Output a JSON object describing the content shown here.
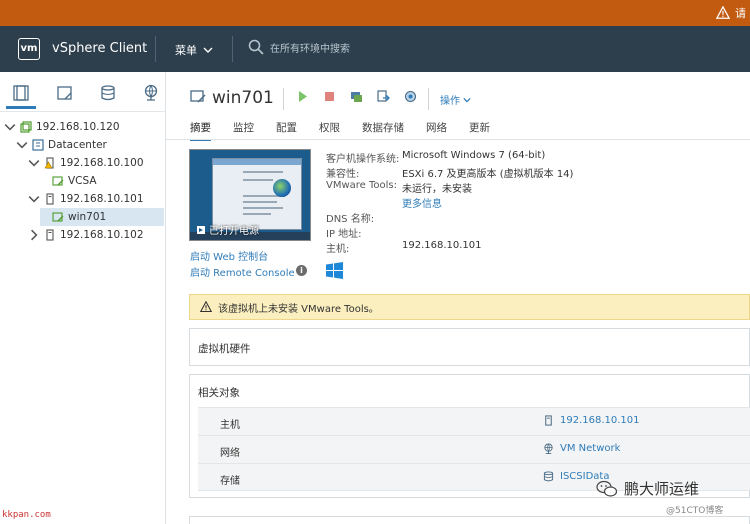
{
  "alert": {
    "text": "请"
  },
  "header": {
    "logo": "vm",
    "app_title": "vSphere Client",
    "menu_label": "菜单",
    "search_placeholder": "在所有环境中搜索"
  },
  "sidebar": {
    "tabs": [
      "hosts-and-clusters-icon",
      "vms-and-templates-icon",
      "storage-icon",
      "networking-icon"
    ],
    "tree": [
      {
        "label": "192.168.10.120",
        "level": 0,
        "expanded": true,
        "icon": "vcenter-icon"
      },
      {
        "label": "Datacenter",
        "level": 1,
        "expanded": true,
        "icon": "datacenter-icon"
      },
      {
        "label": "192.168.10.100",
        "level": 2,
        "expanded": true,
        "icon": "host-warning-icon"
      },
      {
        "label": "VCSA",
        "level": 3,
        "icon": "vm-icon"
      },
      {
        "label": "192.168.10.101",
        "level": 2,
        "expanded": true,
        "icon": "host-icon"
      },
      {
        "label": "win701",
        "level": 3,
        "icon": "vm-icon",
        "selected": true
      },
      {
        "label": "192.168.10.102",
        "level": 2,
        "expanded": false,
        "icon": "host-icon"
      }
    ]
  },
  "vm": {
    "name": "win701",
    "actions_label": "操作",
    "tabs": [
      "摘要",
      "监控",
      "配置",
      "权限",
      "数据存储",
      "网络",
      "更新"
    ],
    "active_tab": "摘要",
    "console_status": "已打开电源",
    "console_links": [
      "启动 Web 控制台",
      "启动 Remote Console"
    ],
    "properties": [
      {
        "label": "客户机操作系统:",
        "value": "Microsoft Windows 7 (64-bit)"
      },
      {
        "label": "兼容性:",
        "value": "ESXi 6.7 及更高版本 (虚拟机版本 14)"
      },
      {
        "label": "VMware Tools:",
        "value": "未运行，未安装"
      },
      {
        "label": "",
        "value": "更多信息"
      },
      {
        "label": "DNS 名称:",
        "value": ""
      },
      {
        "label": "IP 地址:",
        "value": ""
      },
      {
        "label": "主机:",
        "value": "192.168.10.101"
      }
    ],
    "warning_banner": "该虚拟机上未安装 VMware Tools。",
    "hardware_card_title": "虚拟机硬件",
    "related_card_title": "相关对象",
    "related": [
      {
        "key": "主机",
        "value": "192.168.10.101",
        "icon": "host-icon"
      },
      {
        "key": "网络",
        "value": "VM Network",
        "icon": "network-icon"
      },
      {
        "key": "存储",
        "value": "ISCSIData",
        "icon": "datastore-icon"
      }
    ]
  },
  "watermark": {
    "main": "鹏大师运维",
    "sub": "@51CTO博客"
  },
  "source_mark": "kkpan.com",
  "colors": {
    "accent": "#2f7cb9",
    "header_bg": "#2d3f4c",
    "alert_bg": "#c25a10",
    "banner_bg": "#fbeebf"
  }
}
